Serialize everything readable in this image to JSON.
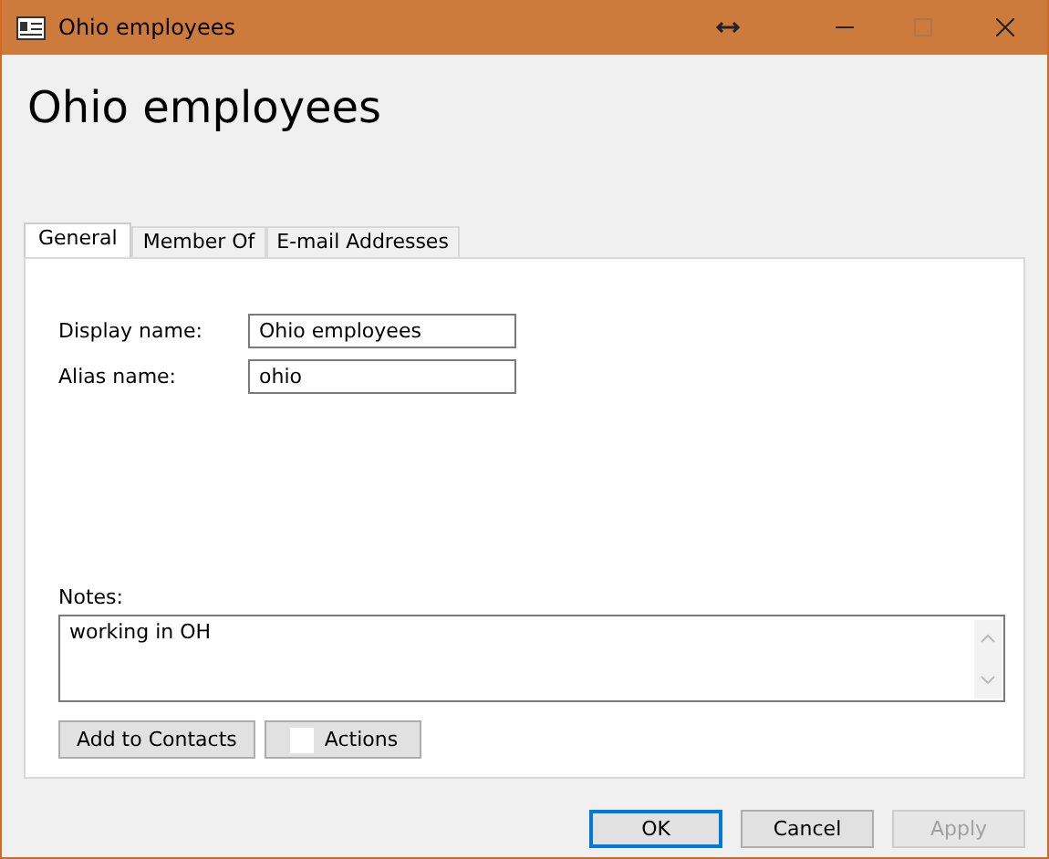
{
  "window": {
    "title": "Ohio employees",
    "controls": [
      {
        "kind": "resize",
        "disabled": false
      },
      {
        "kind": "minimize",
        "disabled": false
      },
      {
        "kind": "maximize",
        "disabled": true
      },
      {
        "kind": "close",
        "disabled": false
      }
    ]
  },
  "heading": "Ohio employees",
  "tabs": [
    {
      "label": "General",
      "selected": true
    },
    {
      "label": "Member Of",
      "selected": false
    },
    {
      "label": "E-mail Addresses",
      "selected": false
    }
  ],
  "fields": [
    {
      "label": "Display name:",
      "value": "Ohio employees"
    },
    {
      "label": "Alias name:",
      "value": "ohio"
    }
  ],
  "notes": {
    "label": "Notes:",
    "value": "working in OH"
  },
  "panel_buttons": [
    {
      "label": "Add to Contacts",
      "kind": "plain"
    },
    {
      "label": "Actions",
      "kind": "swatch"
    }
  ],
  "dialog_buttons": [
    {
      "label": "OK",
      "default": true,
      "disabled": false
    },
    {
      "label": "Cancel",
      "default": false,
      "disabled": false
    },
    {
      "label": "Apply",
      "default": false,
      "disabled": true
    }
  ]
}
